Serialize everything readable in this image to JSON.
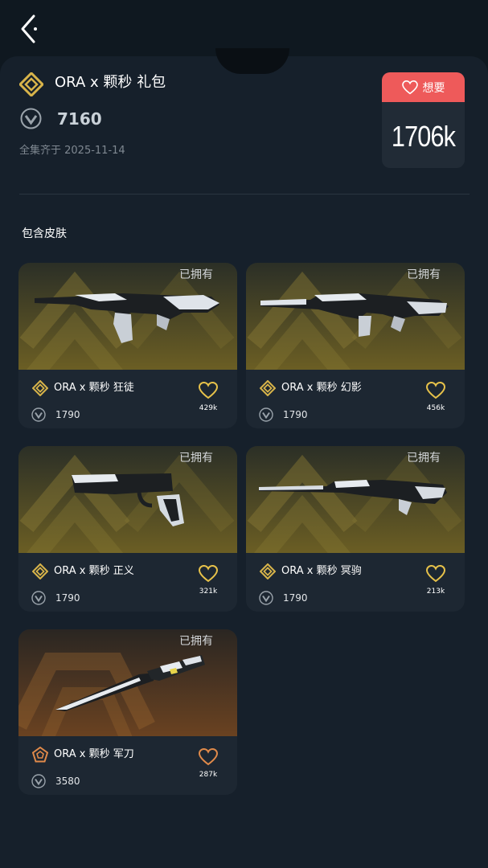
{
  "header": {
    "back_icon": "chevron-left-icon"
  },
  "bundle": {
    "title": "ORA x 颗秒 礼包",
    "tier_icon": "deluxe-tier-icon",
    "price": "7160",
    "currency_icon": "valorant-points-icon",
    "complete_date": "全集齐于 2025-11-14",
    "wishlist_label": "想要",
    "wishlist_count": "1706k",
    "accent_color": "#ee5a5a"
  },
  "section": {
    "title": "包含皮肤"
  },
  "skins": [
    {
      "owned_label": "已拥有",
      "name": "ORA x 颗秒 狂徒",
      "price": "1790",
      "likes": "429k",
      "tier_color": "#d8b44a"
    },
    {
      "owned_label": "已拥有",
      "name": "ORA x 颗秒 幻影",
      "price": "1790",
      "likes": "456k",
      "tier_color": "#d8b44a"
    },
    {
      "owned_label": "已拥有",
      "name": "ORA x 颗秒 正义",
      "price": "1790",
      "likes": "321k",
      "tier_color": "#d8b44a"
    },
    {
      "owned_label": "已拥有",
      "name": "ORA x 颗秒 冥驹",
      "price": "1790",
      "likes": "213k",
      "tier_color": "#d8b44a"
    },
    {
      "owned_label": "已拥有",
      "name": "ORA x 颗秒 军刀",
      "price": "3580",
      "likes": "287k",
      "tier_color": "#e08a4a"
    }
  ]
}
